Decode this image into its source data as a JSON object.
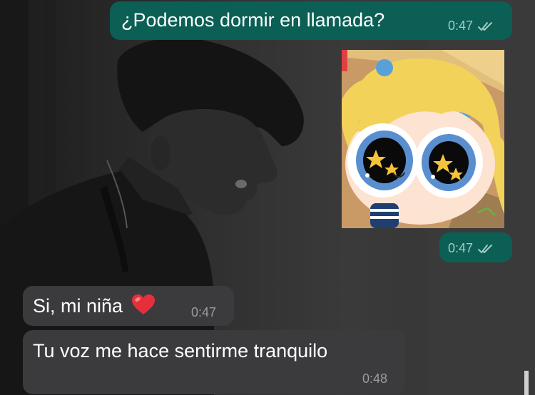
{
  "chat": {
    "messages": [
      {
        "direction": "outgoing",
        "type": "text",
        "text": "¿Podemos dormir en llamada?",
        "time": "0:47",
        "status": "read-double-check-icon"
      },
      {
        "direction": "outgoing",
        "type": "sticker",
        "sticker": "bubbles-star-eyes-sticker",
        "time": "0:47",
        "status": "read-double-check-icon"
      },
      {
        "direction": "incoming",
        "type": "text",
        "text": "Si, mi niña",
        "emoji": "❤️",
        "time": "0:47"
      },
      {
        "direction": "incoming",
        "type": "text",
        "text": "Tu voz me hace sentirme tranquilo",
        "time": "0:48"
      }
    ]
  },
  "colors": {
    "outgoing_bubble": "#0b5f55",
    "incoming_bubble": "#3b3b3d",
    "text": "#ffffff",
    "meta_outgoing": "#a8c9c3",
    "meta_incoming": "#9c9c9c"
  }
}
